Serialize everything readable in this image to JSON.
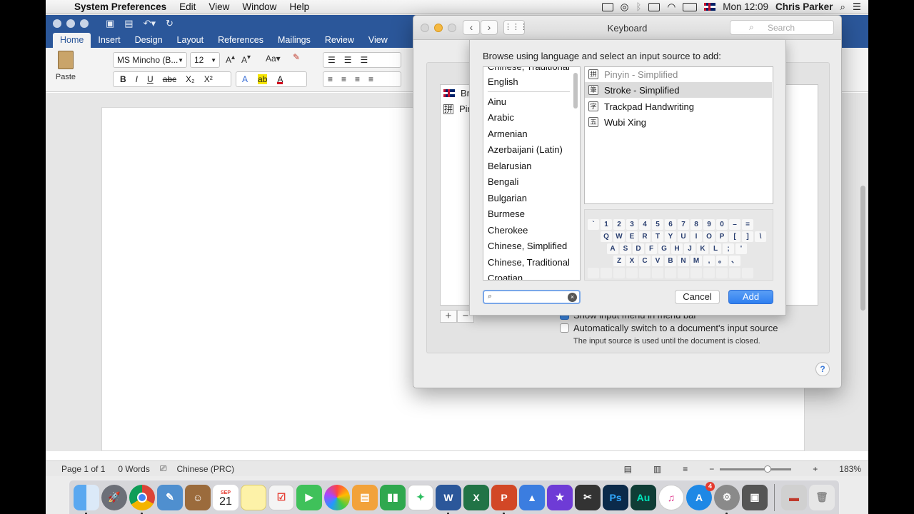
{
  "menubar": {
    "app_name": "System Preferences",
    "items": [
      "Edit",
      "View",
      "Window",
      "Help"
    ],
    "clock": "Mon 12:09",
    "user": "Chris Parker"
  },
  "word": {
    "tabs": [
      "Home",
      "Insert",
      "Design",
      "Layout",
      "References",
      "Mailings",
      "Review",
      "View"
    ],
    "font_name": "MS Mincho (B...",
    "font_size": "12",
    "paste_label": "Paste",
    "status": {
      "page": "Page 1 of 1",
      "words": "0 Words",
      "language": "Chinese (PRC)",
      "zoom": "183%"
    }
  },
  "prefs": {
    "title": "Keyboard",
    "search_placeholder": "Search",
    "sources": [
      "Bri",
      "Pin"
    ],
    "show_input_menu": "Show input menu in menu bar",
    "auto_switch": "Automatically switch to a document's input source",
    "auto_switch_note": "The input source is used until the document is closed.",
    "help": "?"
  },
  "sheet": {
    "prompt": "Browse using language and select an input source to add:",
    "languages": [
      "Chinese, Traditional",
      "English",
      "Ainu",
      "Arabic",
      "Armenian",
      "Azerbaijani (Latin)",
      "Belarusian",
      "Bengali",
      "Bulgarian",
      "Burmese",
      "Cherokee",
      "Chinese, Simplified",
      "Chinese, Traditional",
      "Croatian"
    ],
    "sources": [
      {
        "label": "Pinyin - Simplified",
        "icon": "拼"
      },
      {
        "label": "Stroke - Simplified",
        "icon": "筆"
      },
      {
        "label": "Trackpad Handwriting",
        "icon": "字"
      },
      {
        "label": "Wubi Xing",
        "icon": "五"
      }
    ],
    "keyboard_rows": [
      [
        "`",
        "1",
        "2",
        "3",
        "4",
        "5",
        "6",
        "7",
        "8",
        "9",
        "0",
        "–",
        "="
      ],
      [
        "Q",
        "W",
        "E",
        "R",
        "T",
        "Y",
        "U",
        "I",
        "O",
        "P",
        "[",
        "]",
        "\\"
      ],
      [
        "A",
        "S",
        "D",
        "F",
        "G",
        "H",
        "J",
        "K",
        "L",
        ";",
        "'"
      ],
      [
        "Z",
        "X",
        "C",
        "V",
        "B",
        "N",
        "M",
        ",",
        "。",
        "、"
      ]
    ],
    "cancel": "Cancel",
    "add": "Add"
  },
  "dock": {
    "calendar_month": "SEP",
    "calendar_day": "21",
    "app_store_badge": "4",
    "photoshop": "Ps",
    "audition": "Au"
  }
}
